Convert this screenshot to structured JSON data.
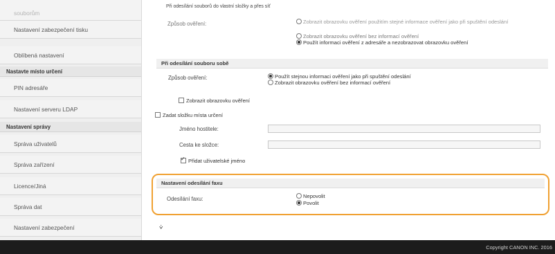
{
  "sidebar": {
    "item_top": "souborům",
    "item_scan_security": "Nastavení zabezpečení tisku",
    "item_favorites": "Oblíbená nastavení",
    "head_destination": "Nastavte místo určení",
    "item_pin": "PIN adresáře",
    "item_ldap": "Nastavení serveru LDAP",
    "head_management": "Nastavení správy",
    "item_users": "Správa uživatelů",
    "item_devices": "Správa zařízení",
    "item_license": "Licence/Jiná",
    "item_data": "Správa dat",
    "item_security": "Nastavení zabezpečení"
  },
  "top": {
    "faded_title": "Při odesílání souborů do vlastní složky a přes síť",
    "auth_label": "Způsob ověření:",
    "opt1": "Zobrazit obrazovku ověření použitím stejné informace ověření jako při spuštění odeslání",
    "opt2": "Zobrazit obrazovku ověření bez informací ověření",
    "opt3": "Použít informaci ověření z adresáře a nezobrazovat obrazovku ověření"
  },
  "self_send": {
    "title": "Při odesílání souboru sobě",
    "auth_label": "Způsob ověření:",
    "opt1": "Použít stejnou informaci ověření jako při spuštění odeslání",
    "opt2": "Zobrazit obrazovku ověření bez informací ověření",
    "show_auth_check": "Zobrazit obrazovku ověření",
    "dest_folder_check": "Zadat složku místa určení",
    "hostname_label": "Jméno hostitele:",
    "path_label": "Cesta ke složce:",
    "add_username_check": "Přidat uživatelské jméno"
  },
  "fax": {
    "title": "Nastavení odesílání faxu",
    "label": "Odesílání faxu:",
    "opt_disallow": "Nepovolit",
    "opt_allow": "Povolit"
  },
  "footer": {
    "copyright": "Copyright CANON INC. 2016"
  },
  "colors": {
    "highlight": "#f0a030",
    "footer_bg": "#1c1c1c"
  }
}
